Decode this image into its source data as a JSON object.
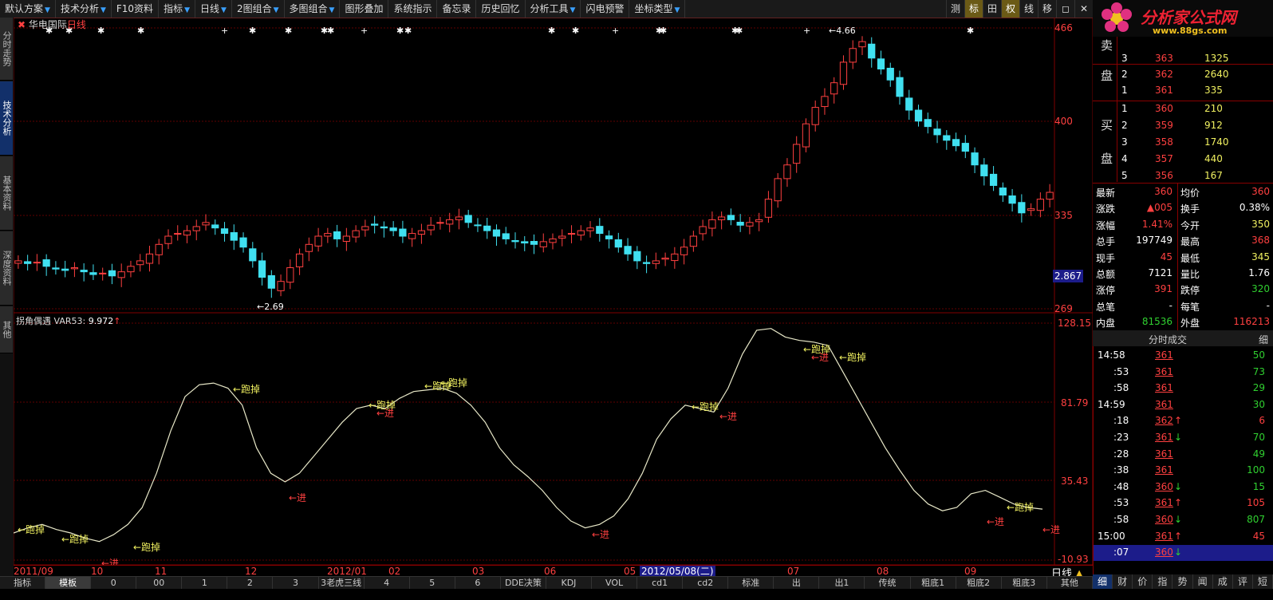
{
  "menu": [
    {
      "label": "默认方案",
      "dd": true
    },
    {
      "label": "技术分析",
      "dd": true
    },
    {
      "label": "F10资料",
      "dd": false
    },
    {
      "label": "指标",
      "dd": true
    },
    {
      "label": "日线",
      "dd": true
    },
    {
      "label": "2图组合",
      "dd": true
    },
    {
      "label": "多图组合",
      "dd": true
    },
    {
      "label": "图形叠加",
      "dd": false
    },
    {
      "label": "系统指示",
      "dd": false
    },
    {
      "label": "备忘录",
      "dd": false
    },
    {
      "label": "历史回忆",
      "dd": false
    },
    {
      "label": "分析工具",
      "dd": true
    },
    {
      "label": "闪电预警",
      "dd": false
    },
    {
      "label": "坐标类型",
      "dd": true
    }
  ],
  "toolbar_right": [
    "测",
    "标",
    "田",
    "权",
    "线",
    "移",
    "◻",
    "✕"
  ],
  "brand": {
    "name": "分析家公式网",
    "url": "www.88gs.com"
  },
  "left_tabs": [
    {
      "label": "分时走势",
      "active": false
    },
    {
      "label": "技术分析",
      "active": true
    },
    {
      "label": "基本资料",
      "active": false
    },
    {
      "label": "深度资料",
      "active": false
    },
    {
      "label": "其他",
      "active": false
    }
  ],
  "stock": {
    "name": "华电国际",
    "cycle": "日线"
  },
  "price_axis": {
    "top": "466",
    "mid1": "400",
    "mid2": "335",
    "low": "269",
    "current": "2.867"
  },
  "price_annotations": {
    "high": "4.66",
    "low": "2.69"
  },
  "indicator": {
    "name": "拐角偶遇",
    "var": "VAR53:",
    "value": "9.972",
    "arrow": "↑"
  },
  "ind_axis": {
    "top": "128.15",
    "mid1": "81.79",
    "mid2": "35.43",
    "low": "-10.93"
  },
  "signals": {
    "run": "跑掉",
    "enter": "进"
  },
  "dates": [
    {
      "label": "2011/09",
      "cur": false
    },
    {
      "label": "10",
      "cur": false
    },
    {
      "label": "11",
      "cur": false
    },
    {
      "label": "12",
      "cur": false
    },
    {
      "label": "2012/01",
      "cur": false
    },
    {
      "label": "02",
      "cur": false
    },
    {
      "label": "03",
      "cur": false
    },
    {
      "label": "06",
      "cur": false
    },
    {
      "label": "05",
      "cur": false
    },
    {
      "label": "2012/05/08(二)",
      "cur": true
    },
    {
      "label": "07",
      "cur": false
    },
    {
      "label": "08",
      "cur": false
    },
    {
      "label": "09",
      "cur": false
    }
  ],
  "period_label": "日线",
  "bottom_tabs": [
    {
      "label": "指标",
      "active": false
    },
    {
      "label": "模板",
      "active": true
    },
    {
      "label": "0",
      "active": false
    },
    {
      "label": "00",
      "active": false
    },
    {
      "label": "1",
      "active": false
    },
    {
      "label": "2",
      "active": false
    },
    {
      "label": "3",
      "active": false
    },
    {
      "label": "3老虎三线",
      "active": false
    },
    {
      "label": "4",
      "active": false
    },
    {
      "label": "5",
      "active": false
    },
    {
      "label": "6",
      "active": false
    },
    {
      "label": "DDE决策",
      "active": false
    },
    {
      "label": "KDJ",
      "active": false
    },
    {
      "label": "VOL",
      "active": false
    },
    {
      "label": "cd1",
      "active": false
    },
    {
      "label": "cd2",
      "active": false
    },
    {
      "label": "标准",
      "active": false
    },
    {
      "label": "出",
      "active": false
    },
    {
      "label": "出1",
      "active": false
    },
    {
      "label": "传统",
      "active": false
    },
    {
      "label": "粗底1",
      "active": false
    },
    {
      "label": "粗底2",
      "active": false
    },
    {
      "label": "粗底3",
      "active": false
    },
    {
      "label": "其他",
      "active": false
    }
  ],
  "sell_side": {
    "label1": "卖",
    "label2": "盘",
    "rows": [
      {
        "n": "3",
        "price": "363",
        "vol": "1325"
      },
      {
        "n": "2",
        "price": "362",
        "vol": "2640"
      },
      {
        "n": "1",
        "price": "361",
        "vol": "335"
      }
    ]
  },
  "buy_side": {
    "label1": "买",
    "label2": "盘",
    "rows": [
      {
        "n": "1",
        "price": "360",
        "vol": "210"
      },
      {
        "n": "2",
        "price": "359",
        "vol": "912"
      },
      {
        "n": "3",
        "price": "358",
        "vol": "1740"
      },
      {
        "n": "4",
        "price": "357",
        "vol": "440"
      },
      {
        "n": "5",
        "price": "356",
        "vol": "167"
      }
    ]
  },
  "quote": [
    {
      "l1": "最新",
      "v1": "360",
      "c1": "red",
      "l2": "均价",
      "v2": "360",
      "c2": "red"
    },
    {
      "l1": "涨跌",
      "v1": "▲005",
      "c1": "red",
      "l2": "换手",
      "v2": "0.38%",
      "c2": "white"
    },
    {
      "l1": "涨幅",
      "v1": "1.41%",
      "c1": "red",
      "l2": "今开",
      "v2": "350",
      "c2": "yellow"
    },
    {
      "l1": "总手",
      "v1": "197749",
      "c1": "white",
      "l2": "最高",
      "v2": "368",
      "c2": "red"
    },
    {
      "l1": "现手",
      "v1": "45",
      "c1": "red",
      "l2": "最低",
      "v2": "345",
      "c2": "yellow"
    },
    {
      "l1": "总额",
      "v1": "7121",
      "c1": "white",
      "l2": "量比",
      "v2": "1.76",
      "c2": "white"
    },
    {
      "l1": "涨停",
      "v1": "391",
      "c1": "red",
      "l2": "跌停",
      "v2": "320",
      "c2": "green"
    },
    {
      "l1": "总笔",
      "v1": "-",
      "c1": "white",
      "l2": "每笔",
      "v2": "-",
      "c2": "white"
    },
    {
      "l1": "内盘",
      "v1": "81536",
      "c1": "green",
      "l2": "外盘",
      "v2": "116213",
      "c2": "red"
    }
  ],
  "ticks_header": {
    "title": "分时成交",
    "detail": "细"
  },
  "ticks": [
    {
      "time": "14:58",
      "price": "361",
      "arrow": "",
      "ac": "",
      "vol": "50",
      "vc": "green"
    },
    {
      "time": ":53",
      "price": "361",
      "arrow": "",
      "ac": "",
      "vol": "73",
      "vc": "green"
    },
    {
      "time": ":58",
      "price": "361",
      "arrow": "",
      "ac": "",
      "vol": "29",
      "vc": "green"
    },
    {
      "time": "14:59",
      "price": "361",
      "arrow": "",
      "ac": "",
      "vol": "30",
      "vc": "green"
    },
    {
      "time": ":18",
      "price": "362",
      "arrow": "↑",
      "ac": "red",
      "vol": "6",
      "vc": "red"
    },
    {
      "time": ":23",
      "price": "361",
      "arrow": "↓",
      "ac": "green",
      "vol": "70",
      "vc": "green"
    },
    {
      "time": ":28",
      "price": "361",
      "arrow": "",
      "ac": "",
      "vol": "49",
      "vc": "green"
    },
    {
      "time": ":38",
      "price": "361",
      "arrow": "",
      "ac": "",
      "vol": "100",
      "vc": "green"
    },
    {
      "time": ":48",
      "price": "360",
      "arrow": "↓",
      "ac": "green",
      "vol": "15",
      "vc": "green"
    },
    {
      "time": ":53",
      "price": "361",
      "arrow": "↑",
      "ac": "red",
      "vol": "105",
      "vc": "red"
    },
    {
      "time": ":58",
      "price": "360",
      "arrow": "↓",
      "ac": "green",
      "vol": "807",
      "vc": "green"
    },
    {
      "time": "15:00",
      "price": "361",
      "arrow": "↑",
      "ac": "red",
      "vol": "45",
      "vc": "red"
    },
    {
      "time": ":07",
      "price": "360",
      "arrow": "↓",
      "ac": "green",
      "vol": "",
      "vc": "green"
    }
  ],
  "rp_tabs": [
    {
      "label": "细",
      "active": true
    },
    {
      "label": "财",
      "active": false
    },
    {
      "label": "价",
      "active": false
    },
    {
      "label": "指",
      "active": false
    },
    {
      "label": "势",
      "active": false
    },
    {
      "label": "闻",
      "active": false
    },
    {
      "label": "成",
      "active": false
    },
    {
      "label": "评",
      "active": false
    },
    {
      "label": "短",
      "active": false
    }
  ],
  "colors": {
    "up": "#ff4040",
    "down": "#40e0f0",
    "grid": "#800000",
    "line": "#e8e8c8",
    "signal_run": "#f0f060",
    "signal_enter": "#ff4040"
  },
  "chart_data": {
    "type": "line",
    "candles_close": [
      300,
      298,
      299,
      296,
      294,
      293,
      295,
      292,
      290,
      291,
      289,
      292,
      296,
      300,
      305,
      312,
      318,
      320,
      322,
      325,
      328,
      324,
      320,
      315,
      310,
      300,
      288,
      280,
      285,
      295,
      305,
      312,
      318,
      320,
      316,
      318,
      322,
      325,
      326,
      324,
      322,
      318,
      320,
      322,
      326,
      328,
      330,
      332,
      328,
      326,
      322,
      318,
      316,
      314,
      313,
      312,
      314,
      316,
      318,
      320,
      322,
      324,
      320,
      316,
      310,
      305,
      300,
      298,
      300,
      302,
      305,
      310,
      318,
      325,
      330,
      332,
      330,
      326,
      328,
      330,
      345,
      360,
      370,
      385,
      400,
      412,
      420,
      430,
      445,
      455,
      460,
      448,
      440,
      432,
      420,
      410,
      402,
      398,
      392,
      388,
      384,
      380,
      370,
      362,
      355,
      348,
      342,
      335,
      338,
      345,
      350
    ],
    "indicator_line": [
      5,
      8,
      10,
      7,
      5,
      2,
      0,
      4,
      10,
      20,
      40,
      65,
      85,
      92,
      93,
      90,
      80,
      55,
      40,
      35,
      40,
      50,
      60,
      70,
      78,
      80,
      78,
      84,
      88,
      89,
      90,
      87,
      80,
      70,
      55,
      45,
      38,
      30,
      20,
      12,
      8,
      10,
      15,
      25,
      40,
      60,
      72,
      80,
      78,
      76,
      90,
      110,
      124,
      125,
      120,
      118,
      117,
      115,
      100,
      85,
      70,
      55,
      42,
      30,
      22,
      18,
      20,
      28,
      30,
      26,
      22,
      20,
      19
    ]
  }
}
